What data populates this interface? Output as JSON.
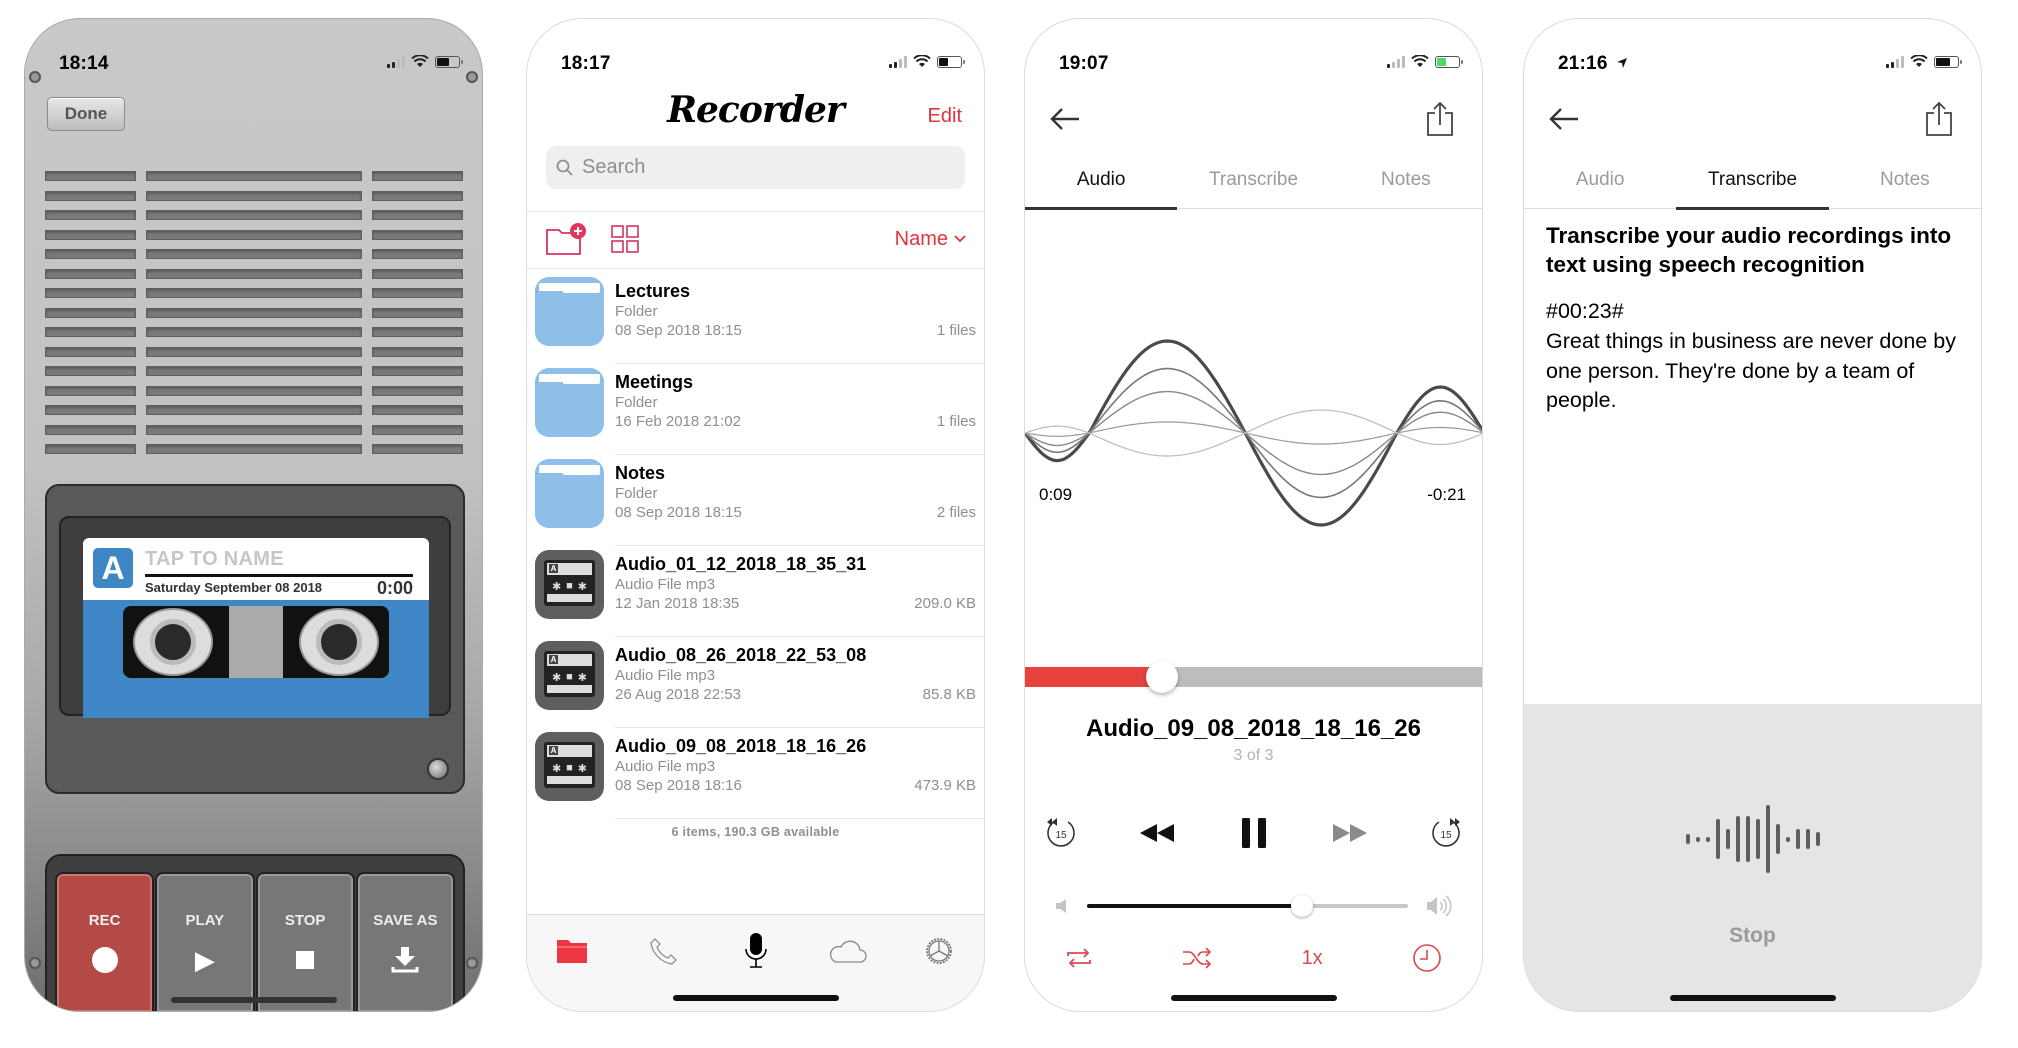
{
  "screens": {
    "recorder": {
      "status": {
        "time": "18:14"
      },
      "done_label": "Done",
      "cassette": {
        "letter": "A",
        "name_placeholder": "TAP TO NAME",
        "date": "Saturday September 08 2018",
        "elapsed": "0:00",
        "tape_color": "#3f86c6"
      },
      "keys": [
        {
          "label": "REC",
          "icon": "record-icon"
        },
        {
          "label": "PLAY",
          "icon": "play-icon"
        },
        {
          "label": "STOP",
          "icon": "stop-icon"
        },
        {
          "label": "SAVE AS",
          "icon": "download-icon"
        }
      ]
    },
    "files": {
      "status": {
        "time": "18:17"
      },
      "title": "Recorder",
      "edit_label": "Edit",
      "search_placeholder": "Search",
      "sort_label": "Name",
      "accent": "#e0343d",
      "items": [
        {
          "kind": "folder",
          "name": "Lectures",
          "type": "Folder",
          "date": "08 Sep 2018 18:15",
          "meta": "1 files"
        },
        {
          "kind": "folder",
          "name": "Meetings",
          "type": "Folder",
          "date": "16 Feb 2018 21:02",
          "meta": "1 files"
        },
        {
          "kind": "folder",
          "name": "Notes",
          "type": "Folder",
          "date": "08 Sep 2018 18:15",
          "meta": "2 files"
        },
        {
          "kind": "audio",
          "name": "Audio_01_12_2018_18_35_31",
          "type": "Audio File mp3",
          "date": "12 Jan 2018 18:35",
          "meta": "209.0 KB"
        },
        {
          "kind": "audio",
          "name": "Audio_08_26_2018_22_53_08",
          "type": "Audio File mp3",
          "date": "26 Aug 2018 22:53",
          "meta": "85.8 KB"
        },
        {
          "kind": "audio",
          "name": "Audio_09_08_2018_18_16_26",
          "type": "Audio File mp3",
          "date": "08 Sep 2018 18:16",
          "meta": "473.9 KB"
        }
      ],
      "footer": "6 items, 190.3 GB available",
      "tabbar": [
        {
          "name": "files",
          "icon": "folder-icon",
          "active": true
        },
        {
          "name": "calls",
          "icon": "phone-icon",
          "active": false
        },
        {
          "name": "record",
          "icon": "microphone-icon",
          "active": false
        },
        {
          "name": "cloud",
          "icon": "cloud-icon",
          "active": false
        },
        {
          "name": "settings",
          "icon": "gear-icon",
          "active": false
        }
      ]
    },
    "player": {
      "status": {
        "time": "19:07",
        "charging": true
      },
      "tabs": [
        "Audio",
        "Transcribe",
        "Notes"
      ],
      "active_tab": 0,
      "elapsed": "0:09",
      "remaining": "-0:21",
      "progress_fraction": 0.3,
      "track_title": "Audio_09_08_2018_18_16_26",
      "track_position": "3 of 3",
      "skip_seconds": "15",
      "volume_fraction": 0.67,
      "speed_label": "1x",
      "accent": "#e8423f"
    },
    "transcribe": {
      "status": {
        "time": "21:16"
      },
      "tabs": [
        "Audio",
        "Transcribe",
        "Notes"
      ],
      "active_tab": 1,
      "heading": "Transcribe your audio recordings into text using speech recognition",
      "timestamp": "#00:23#",
      "text": "Great things in business are never done by one person. They're done by a team of people.",
      "stop_label": "Stop"
    }
  }
}
